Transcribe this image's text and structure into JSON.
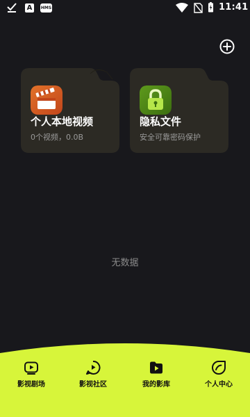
{
  "status_bar": {
    "time": "11:41",
    "left_icons": [
      "check-icon",
      "a-app-icon",
      "hms-icon"
    ],
    "hms_label": "HMS",
    "a_label": "A",
    "right_icons": [
      "wifi-icon",
      "no-sim-icon",
      "battery-charging-icon"
    ]
  },
  "header": {
    "add_icon": "plus-circle-icon"
  },
  "folders": [
    {
      "title": "个人本地视频",
      "subtitle": "0个视频，0.0B",
      "icon": "clapperboard-icon"
    },
    {
      "title": "隐私文件",
      "subtitle": "安全可靠密码保护",
      "icon": "lock-icon"
    }
  ],
  "empty_state": {
    "text": "无数据"
  },
  "bottom_nav": {
    "items": [
      {
        "label": "影视剧场",
        "icon": "play-screen-icon"
      },
      {
        "label": "影视社区",
        "icon": "play-chat-icon"
      },
      {
        "label": "我的影库",
        "icon": "play-folder-icon",
        "active": true
      },
      {
        "label": "个人中心",
        "icon": "profile-leaf-icon"
      }
    ]
  },
  "colors": {
    "background": "#18181c",
    "card": "#2c2a24",
    "accent_nav": "#d7f53a"
  }
}
